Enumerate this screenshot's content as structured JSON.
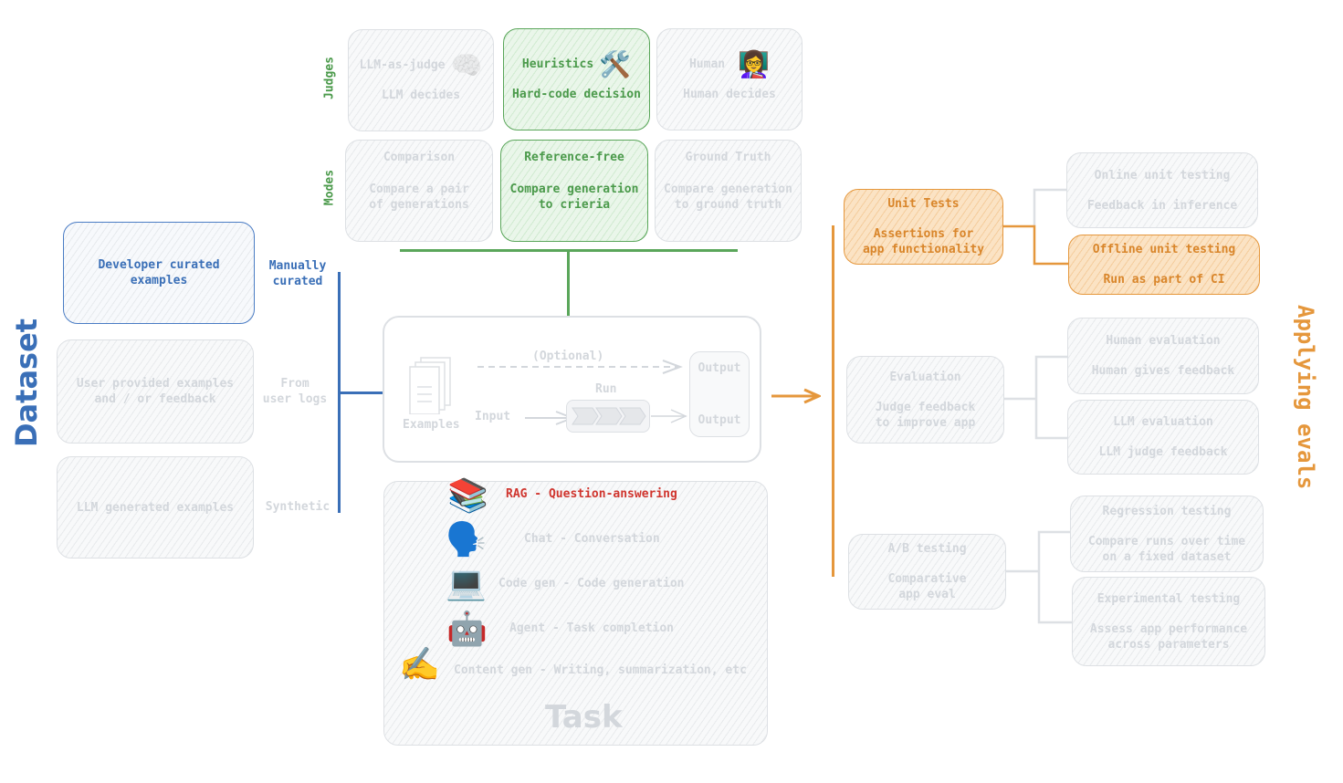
{
  "title_left": "Dataset",
  "title_right": "Applying evals",
  "colors": {
    "dataset": "#3a6fb7",
    "judges": "#4b9a4b",
    "apply": "#e5973c",
    "rag": "#d0352e",
    "muted": "#d3d7dc"
  },
  "judges": {
    "label": "Judges",
    "items": [
      {
        "title": "LLM-as-judge",
        "desc": "LLM decides",
        "icon": "brain-icon",
        "glyph": "🧠",
        "active": false
      },
      {
        "title": "Heuristics",
        "desc": "Hard-code decision",
        "icon": "hammer-wrench-icon",
        "glyph": "🛠️",
        "active": true
      },
      {
        "title": "Human",
        "desc": "Human decides",
        "icon": "teacher-icon",
        "glyph": "👩‍🏫",
        "active": false
      }
    ]
  },
  "modes": {
    "label": "Modes",
    "items": [
      {
        "title": "Comparison",
        "desc1": "Compare a pair",
        "desc2": "of generations",
        "active": false
      },
      {
        "title": "Reference-free",
        "desc1": "Compare generation",
        "desc2": "to crieria",
        "active": true
      },
      {
        "title": "Ground Truth",
        "desc1": "Compare generation",
        "desc2": "to ground truth",
        "active": false
      }
    ]
  },
  "dataset": {
    "items": [
      {
        "text1": "Developer curated",
        "text2": "examples",
        "label1": "Manually",
        "label2": "curated",
        "active": true
      },
      {
        "text1": "User provided examples",
        "text2": "and / or feedback",
        "label1": "From",
        "label2": "user logs",
        "active": false
      },
      {
        "text1": "LLM generated examples",
        "text2": "",
        "label1": "Synthetic",
        "label2": "",
        "active": false
      }
    ]
  },
  "pipeline": {
    "examples_label": "Examples",
    "optional_label": "(Optional)",
    "input_label": "Input",
    "run_label": "Run",
    "output_top": "Output",
    "output_bottom": "Output"
  },
  "task": {
    "title": "Task",
    "items": [
      {
        "glyph": "📚",
        "icon": "books-icon",
        "text": "RAG - Question-answering",
        "active": true
      },
      {
        "glyph": "🗣️",
        "icon": "speaking-head-icon",
        "text": "Chat - Conversation",
        "active": false
      },
      {
        "glyph": "💻",
        "icon": "laptop-icon",
        "text": "Code gen - Code generation",
        "active": false
      },
      {
        "glyph": "🤖",
        "icon": "robot-icon",
        "text": "Agent - Task completion",
        "active": false
      },
      {
        "glyph": "✍️",
        "icon": "writing-hand-icon",
        "text": "Content gen - Writing, summarization, etc",
        "active": false
      }
    ]
  },
  "apply": {
    "groups": [
      {
        "title": "Unit Tests",
        "desc1": "Assertions for",
        "desc2": "app functionality",
        "active": true,
        "children": [
          {
            "title": "Online unit testing",
            "desc1": "Feedback in inference",
            "desc2": "",
            "active": false
          },
          {
            "title": "Offline unit testing",
            "desc1": "Run as part of CI",
            "desc2": "",
            "active": true
          }
        ]
      },
      {
        "title": "Evaluation",
        "desc1": "Judge feedback",
        "desc2": "to improve app",
        "active": false,
        "children": [
          {
            "title": "Human evaluation",
            "desc1": "Human gives feedback",
            "desc2": "",
            "active": false
          },
          {
            "title": "LLM evaluation",
            "desc1": "LLM judge feedback",
            "desc2": "",
            "active": false
          }
        ]
      },
      {
        "title": "A/B testing",
        "desc1": "Comparative",
        "desc2": "app eval",
        "active": false,
        "children": [
          {
            "title": "Regression testing",
            "desc1": "Compare runs over time",
            "desc2": "on a fixed dataset",
            "active": false
          },
          {
            "title": "Experimental testing",
            "desc1": "Assess app performance",
            "desc2": "across parameters",
            "active": false
          }
        ]
      }
    ]
  }
}
